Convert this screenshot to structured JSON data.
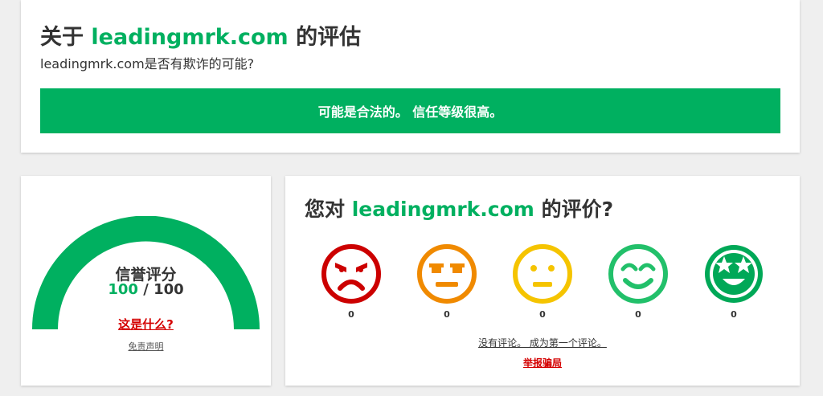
{
  "header": {
    "title_prefix": "关于",
    "domain": "leadingmrk.com",
    "title_suffix": "的评估",
    "subtitle": "leadingmrk.com是否有欺诈的可能?",
    "verdict": "可能是合法的。 信任等级很高。"
  },
  "trust_score": {
    "label": "信誉评分",
    "value": "100",
    "separator": "/",
    "max": "100",
    "fill_fraction": 1.0,
    "what_link": "这是什么?",
    "disclaimer": "免责声明"
  },
  "review": {
    "title_prefix": "您对",
    "domain": "leadingmrk.com",
    "title_suffix": "的评价?",
    "faces": [
      {
        "icon": "angry-face-icon",
        "color": "#cc0000",
        "count": "0"
      },
      {
        "icon": "annoyed-face-icon",
        "color": "#f08a00",
        "count": "0"
      },
      {
        "icon": "neutral-face-icon",
        "color": "#f5c400",
        "count": "0"
      },
      {
        "icon": "smiling-face-icon",
        "color": "#22c06a",
        "count": "0"
      },
      {
        "icon": "star-eyes-face-icon",
        "color": "#00a857",
        "count": "0"
      }
    ],
    "no_reviews": "没有评论。 成为第一个评论。",
    "report": "举报骗局"
  },
  "colors": {
    "accent": "#00b060",
    "danger": "#d40000",
    "background": "#efefef"
  }
}
